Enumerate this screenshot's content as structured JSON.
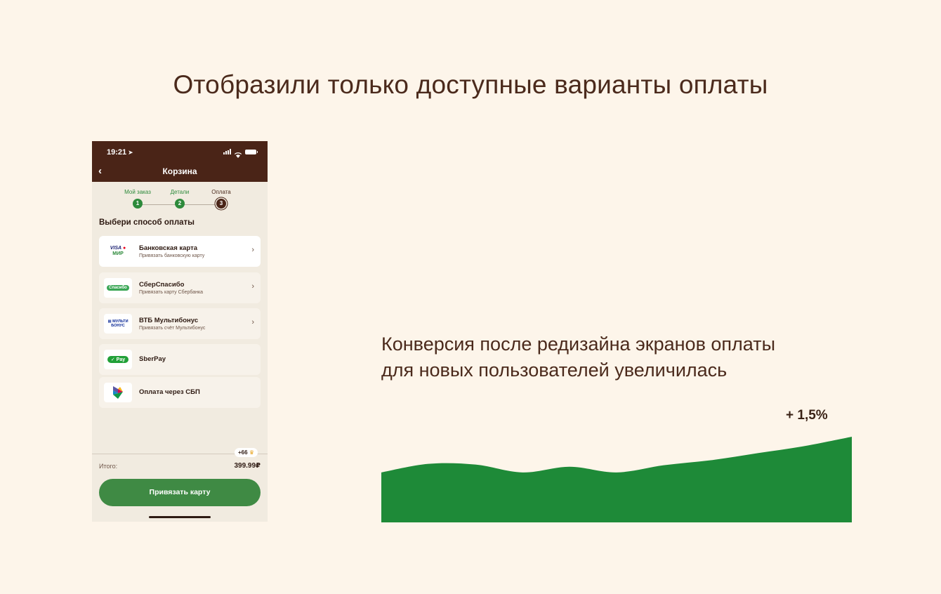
{
  "slide_title": "Отобразили только доступные варианты оплаты",
  "phone": {
    "status": {
      "time": "19:21",
      "location_icon": "location-arrow-icon"
    },
    "nav": {
      "back_icon": "chevron-left-icon",
      "title": "Корзина"
    },
    "steps": [
      {
        "label": "Мой заказ",
        "number": "1",
        "state": "done"
      },
      {
        "label": "Детали",
        "number": "2",
        "state": "done"
      },
      {
        "label": "Оплата",
        "number": "3",
        "state": "current"
      }
    ],
    "payment_heading": "Выбери способ оплаты",
    "options": [
      {
        "title": "Банковская карта",
        "subtitle": "Привязать банковскую карту",
        "logo": "VISA MIR",
        "has_arrow": true
      },
      {
        "title": "СберСпасибо",
        "subtitle": "Привязать карту Сбербанка",
        "logo": "Спасибо",
        "has_arrow": true
      },
      {
        "title": "ВТБ Мультибонус",
        "subtitle": "Привязать счёт Мультибонус",
        "logo": "МУЛЬТИ БОНУС",
        "has_arrow": true
      },
      {
        "title": "SberPay",
        "subtitle": "",
        "logo": "Pay",
        "has_arrow": false
      },
      {
        "title": "Оплата через СБП",
        "subtitle": "",
        "logo": "СБП",
        "has_arrow": false
      }
    ],
    "bonus_badge": "+66",
    "total_label": "Итого:",
    "total_value": "399.99₽",
    "cta_label": "Привязать карту"
  },
  "conversion": {
    "line1": "Конверсия после редизайна экранов оплаты",
    "line2": "для новых пользователей увеличилась",
    "delta": "+ 1,5%"
  },
  "chart_data": {
    "type": "area",
    "title": "",
    "xlabel": "",
    "ylabel": "",
    "x": [
      0,
      1,
      2,
      3,
      4,
      5,
      6,
      7,
      8,
      9,
      10
    ],
    "series": [
      {
        "values": [
          70,
          82,
          81,
          70,
          78,
          70,
          80,
          87,
          97,
          107,
          120
        ]
      }
    ],
    "ylim": [
      0,
      120
    ],
    "color": "#1e8a38",
    "grid": false
  },
  "colors": {
    "background": "#fdf5ea",
    "brand_brown": "#4a2417",
    "accent_green": "#2d8a3b",
    "cta_green": "#3f8a44"
  }
}
